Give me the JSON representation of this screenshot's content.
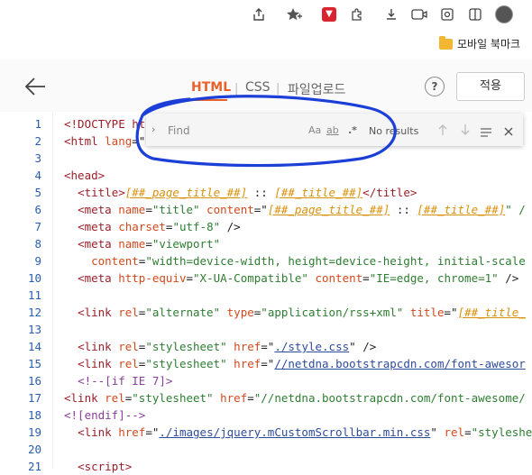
{
  "browser": {
    "bookmarks": [
      {
        "label": "모바일 북마크",
        "icon": "folder-icon"
      }
    ]
  },
  "editor": {
    "tabs": [
      {
        "label": "HTML",
        "active": true
      },
      {
        "label": "CSS",
        "active": false
      },
      {
        "label": "파일업로드",
        "active": false
      }
    ],
    "tab_separator": "|",
    "help_label": "?",
    "apply_label": "적용",
    "accent_color": "#e8632b"
  },
  "find": {
    "placeholder": "Find",
    "match_case": "Aa",
    "whole_word": "ab",
    "regex": ".*",
    "status": "No results"
  },
  "code": {
    "line_numbers": [
      "1",
      "2",
      "3",
      "4",
      "5",
      "6",
      "7",
      "8",
      "9",
      "10",
      "11",
      "12",
      "13",
      "14",
      "15",
      "16",
      "17",
      "18",
      "19",
      "20",
      "21"
    ],
    "lines": [
      [
        [
          "t-tag",
          "<!DOCTYPE ht"
        ]
      ],
      [
        [
          "t-tag",
          "<html "
        ],
        [
          "t-attr",
          "lang"
        ],
        [
          "",
          "=\""
        ]
      ],
      [],
      [
        [
          "t-tag",
          "<head>"
        ]
      ],
      [
        [
          "",
          "  "
        ],
        [
          "t-tag",
          "<title>"
        ],
        [
          "t-tpl",
          "[##_page_title_##]"
        ],
        [
          "",
          " :: "
        ],
        [
          "t-tpl",
          "[##_title_##]"
        ],
        [
          "t-tag",
          "</title>"
        ]
      ],
      [
        [
          "",
          "  "
        ],
        [
          "t-tag",
          "<meta "
        ],
        [
          "t-attr",
          "name"
        ],
        [
          "",
          "="
        ],
        [
          "t-str",
          "\"title\""
        ],
        [
          "",
          " "
        ],
        [
          "t-attr",
          "content"
        ],
        [
          "",
          "=\""
        ],
        [
          "t-tpl",
          "[##_page_title_##]"
        ],
        [
          "",
          " :: "
        ],
        [
          "t-tpl",
          "[##_title_##]"
        ],
        [
          "t-str",
          "\" /"
        ]
      ],
      [
        [
          "",
          "  "
        ],
        [
          "t-tag",
          "<meta "
        ],
        [
          "t-attr",
          "charset"
        ],
        [
          "",
          "="
        ],
        [
          "t-str",
          "\"utf-8\""
        ],
        [
          "",
          " />"
        ]
      ],
      [
        [
          "",
          "  "
        ],
        [
          "t-tag",
          "<meta "
        ],
        [
          "t-attr",
          "name"
        ],
        [
          "",
          "="
        ],
        [
          "t-str",
          "\"viewport\""
        ]
      ],
      [
        [
          "",
          "    "
        ],
        [
          "t-attr",
          "content"
        ],
        [
          "",
          "="
        ],
        [
          "t-str",
          "\"width=device-width, height=device-height, initial-scale"
        ]
      ],
      [
        [
          "",
          "  "
        ],
        [
          "t-tag",
          "<meta "
        ],
        [
          "t-attr",
          "http-equiv"
        ],
        [
          "",
          "="
        ],
        [
          "t-str",
          "\"X-UA-Compatible\""
        ],
        [
          "",
          " "
        ],
        [
          "t-attr",
          "content"
        ],
        [
          "",
          "="
        ],
        [
          "t-str",
          "\"IE=edge, chrome=1\""
        ],
        [
          "",
          " />"
        ]
      ],
      [],
      [
        [
          "",
          "  "
        ],
        [
          "t-tag",
          "<link "
        ],
        [
          "t-attr",
          "rel"
        ],
        [
          "",
          "="
        ],
        [
          "t-str",
          "\"alternate\""
        ],
        [
          "",
          " "
        ],
        [
          "t-attr",
          "type"
        ],
        [
          "",
          "="
        ],
        [
          "t-str",
          "\"application/rss+xml\""
        ],
        [
          "",
          " "
        ],
        [
          "t-attr",
          "title"
        ],
        [
          "",
          "=\""
        ],
        [
          "t-tpl",
          "[##_title_"
        ]
      ],
      [],
      [
        [
          "",
          "  "
        ],
        [
          "t-tag",
          "<link "
        ],
        [
          "t-attr",
          "rel"
        ],
        [
          "",
          "="
        ],
        [
          "t-str",
          "\"stylesheet\""
        ],
        [
          "",
          " "
        ],
        [
          "t-attr",
          "href"
        ],
        [
          "",
          "=\""
        ],
        [
          "t-url",
          "./style.css"
        ],
        [
          "",
          "\" />"
        ]
      ],
      [
        [
          "",
          "  "
        ],
        [
          "t-tag",
          "<link "
        ],
        [
          "t-attr",
          "rel"
        ],
        [
          "",
          "="
        ],
        [
          "t-str",
          "\"stylesheet\""
        ],
        [
          "",
          " "
        ],
        [
          "t-attr",
          "href"
        ],
        [
          "",
          "=\""
        ],
        [
          "t-url",
          "//netdna.bootstrapcdn.com/font-awesor"
        ]
      ],
      [
        [
          "",
          "  "
        ],
        [
          "t-com",
          "<!--[if IE 7]>"
        ]
      ],
      [
        [
          "t-tag",
          "<link "
        ],
        [
          "t-attr",
          "rel"
        ],
        [
          "",
          "="
        ],
        [
          "t-str",
          "\"stylesheet\""
        ],
        [
          "",
          " "
        ],
        [
          "t-attr",
          "href"
        ],
        [
          "",
          "="
        ],
        [
          "t-str",
          "\"//netdna.bootstrapcdn.com/font-awesome/"
        ]
      ],
      [
        [
          "t-com",
          "<![endif]-->"
        ]
      ],
      [
        [
          "",
          "  "
        ],
        [
          "t-tag",
          "<link "
        ],
        [
          "t-attr",
          "href"
        ],
        [
          "",
          "=\""
        ],
        [
          "t-url",
          "./images/jquery.mCustomScrollbar.min.css"
        ],
        [
          "",
          "\" "
        ],
        [
          "t-attr",
          "rel"
        ],
        [
          "",
          "="
        ],
        [
          "t-str",
          "\"styleshe"
        ]
      ],
      [],
      [
        [
          "",
          "  "
        ],
        [
          "t-tag",
          "<script>"
        ]
      ]
    ]
  }
}
